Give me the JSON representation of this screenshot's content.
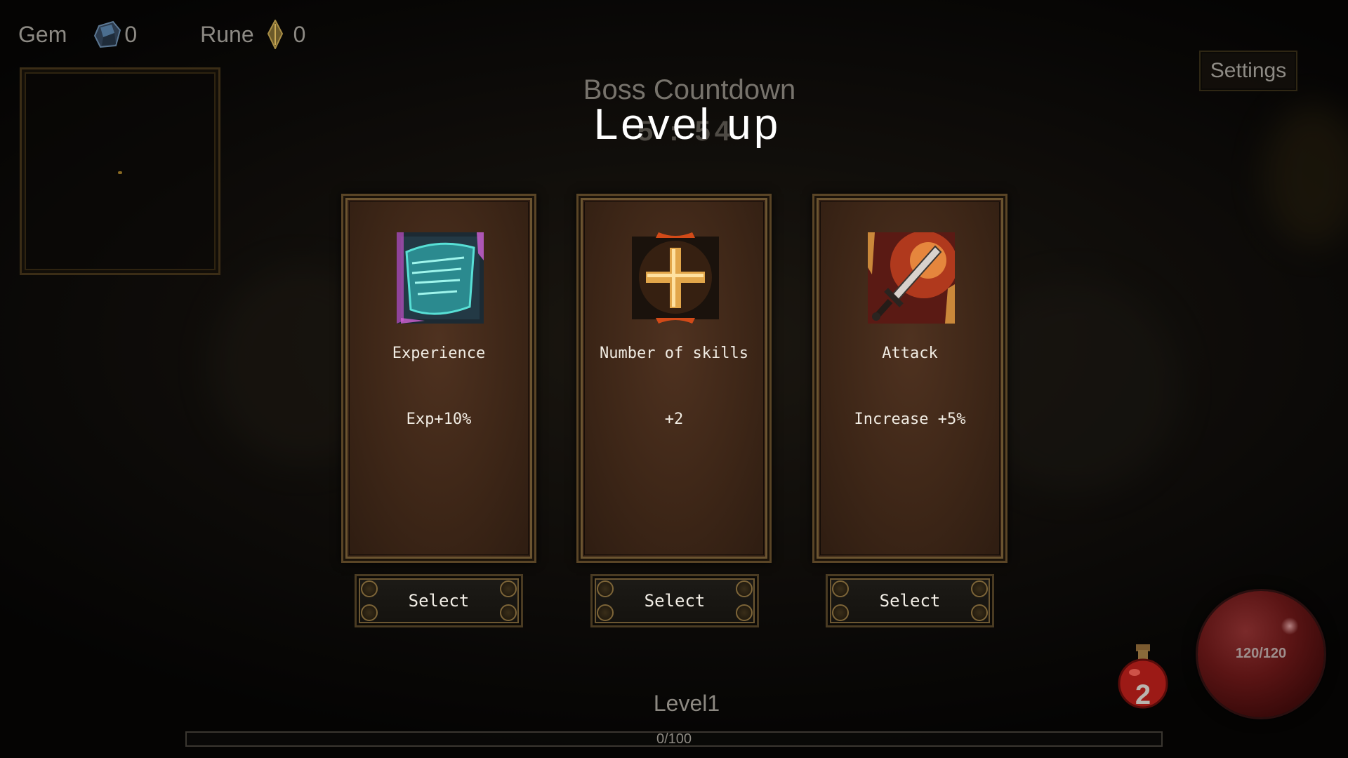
{
  "hud": {
    "gem_label": "Gem",
    "gem_count": "0",
    "rune_label": "Rune",
    "rune_count": "0"
  },
  "settings_label": "Settings",
  "boss": {
    "label": "Boss Countdown",
    "time": "5 : 54"
  },
  "level_up_title": "Level up",
  "cards": [
    {
      "icon": "experience-scroll-icon",
      "title": "Experience",
      "description": "Exp+10%",
      "button_label": "Select"
    },
    {
      "icon": "plus-skill-icon",
      "title": "Number of skills",
      "description": "+2",
      "button_label": "Select"
    },
    {
      "icon": "sword-attack-icon",
      "title": "Attack",
      "description": "Increase +5%",
      "button_label": "Select"
    }
  ],
  "player": {
    "level_text": "Level1",
    "xp_text": "0/100",
    "xp_fraction": 0,
    "potion_count": "2",
    "hp_text": "120/120"
  },
  "colors": {
    "card_border": "#6b5430",
    "card_bg": "#3d2617",
    "hp_orb": "#5a1414",
    "text_light": "#f1ece3"
  }
}
